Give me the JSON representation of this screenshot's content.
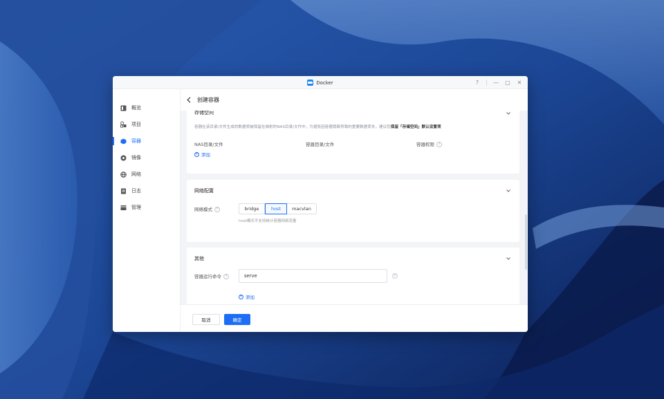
{
  "window": {
    "title": "Docker",
    "controls": {
      "help": "?",
      "minimize": "—",
      "maximize": "□",
      "close": "✕"
    }
  },
  "sidebar": {
    "items": [
      {
        "label": "概览",
        "icon": "overview-icon",
        "active": false
      },
      {
        "label": "项目",
        "icon": "project-icon",
        "active": false
      },
      {
        "label": "容器",
        "icon": "container-icon",
        "active": true
      },
      {
        "label": "镜像",
        "icon": "image-icon",
        "active": false
      },
      {
        "label": "网络",
        "icon": "network-icon",
        "active": false
      },
      {
        "label": "日志",
        "icon": "log-icon",
        "active": false
      },
      {
        "label": "管理",
        "icon": "manage-icon",
        "active": false
      }
    ]
  },
  "header": {
    "title": "创建容器"
  },
  "storage": {
    "title": "存储空间",
    "desc_prefix": "容器在该目录/文件生成的数据将被保留在映射的NAS目录/文件中，为避免因容器销毁导致的重要数据丢失，建议您",
    "desc_bold": "保留「存储空间」默认设置项",
    "col_nas": "NAS目录/文件",
    "col_container": "容器目录/文件",
    "col_permission": "容器权限",
    "add_label": "添加"
  },
  "network": {
    "title": "网络配置",
    "mode_label": "网络模式",
    "options": [
      "bridge",
      "host",
      "macvlan"
    ],
    "selected": "host",
    "hint": "host模式不支持统计容器网络流量"
  },
  "other": {
    "title": "其他",
    "cmd_label": "容器运行命令",
    "cmd_value": "serve",
    "add_label": "添加"
  },
  "footer": {
    "cancel": "取消",
    "confirm": "确定"
  },
  "colors": {
    "accent": "#1e6ef5",
    "wallpaper": "#1a3f86"
  }
}
